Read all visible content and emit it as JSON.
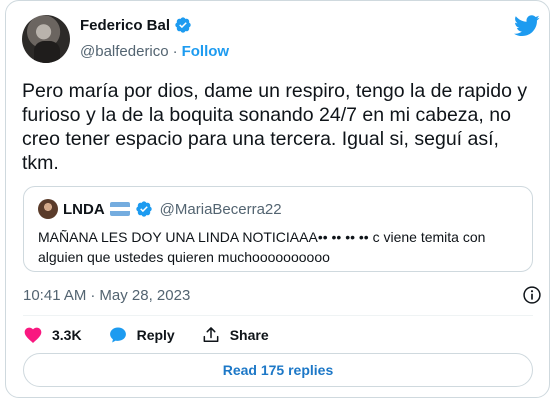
{
  "author": {
    "display_name": "Federico Bal",
    "handle": "@balfederico",
    "separator": "·",
    "follow_label": "Follow"
  },
  "tweet": {
    "text": "Pero maría por dios, dame un respiro, tengo la de rapido y furioso y la de la boquita sonando 24/7 en mi cabeza, no creo tener espacio para una tercera. Igual si, seguí así, tkm."
  },
  "quoted_tweet": {
    "display_name": "LNDA",
    "handle": "@MariaBecerra22",
    "text": "MAÑANA LES DOY UNA LINDA NOTICIAAA•• •• •• •• c viene temita con alguien que ustedes quieren muchoooooooooo"
  },
  "meta": {
    "time": "10:41 AM",
    "separator": "·",
    "date": "May 28, 2023"
  },
  "actions": {
    "like_count": "3.3K",
    "reply_label": "Reply",
    "share_label": "Share"
  },
  "read_replies_label": "Read 175 replies",
  "colors": {
    "accent": "#1d9bf0",
    "like": "#f91880",
    "text_secondary": "#536471",
    "border": "#cfd9de"
  }
}
